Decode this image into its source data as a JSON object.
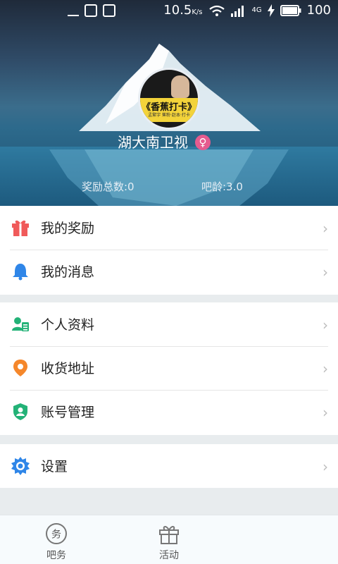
{
  "status_bar": {
    "speed": "10.5",
    "speed_unit": "K/s",
    "network": "4G",
    "battery": "100"
  },
  "profile": {
    "avatar_text": "《香蕉打卡》",
    "avatar_subtext": "孟繁宇 蕉粉·赵本·打卡",
    "username": "湖大南卫视",
    "gender_symbol": "♀",
    "rewards_label": "奖励总数:0",
    "age_label": "吧龄:3.0"
  },
  "menu": {
    "group1": [
      {
        "label": "我的奖励",
        "icon": "gift-icon"
      },
      {
        "label": "我的消息",
        "icon": "bell-icon"
      }
    ],
    "group2": [
      {
        "label": "个人资料",
        "icon": "profile-card-icon"
      },
      {
        "label": "收货地址",
        "icon": "location-pin-icon"
      },
      {
        "label": "账号管理",
        "icon": "shield-user-icon"
      }
    ],
    "group3": [
      {
        "label": "设置",
        "icon": "gear-icon"
      }
    ],
    "chevron": "›"
  },
  "tabs": [
    {
      "label": "吧务",
      "icon_text": "务"
    },
    {
      "label": "活动"
    }
  ],
  "colors": {
    "gift": "#f05a5a",
    "bell": "#2f86e8",
    "profile": "#23b277",
    "location": "#f5872b",
    "shield": "#23b277",
    "gear": "#2f86e8"
  }
}
